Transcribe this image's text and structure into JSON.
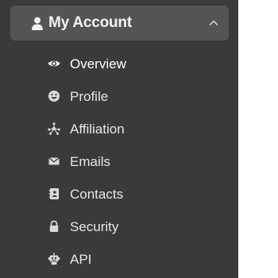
{
  "colors": {
    "sidebar_bg": "#3a3a3a",
    "header_bg": "#545454",
    "text": "#e6e6e6",
    "icon": "#d9d9d9"
  },
  "account": {
    "title": "My Account",
    "icon": "user-icon",
    "expanded": true,
    "items": [
      {
        "label": "Overview",
        "icon": "eye-icon",
        "active": true
      },
      {
        "label": "Profile",
        "icon": "smiley-icon",
        "active": false
      },
      {
        "label": "Affiliation",
        "icon": "network-icon",
        "active": false
      },
      {
        "label": "Emails",
        "icon": "envelope-icon",
        "active": false
      },
      {
        "label": "Contacts",
        "icon": "address-book-icon",
        "active": false
      },
      {
        "label": "Security",
        "icon": "lock-icon",
        "active": false
      },
      {
        "label": "API",
        "icon": "robot-icon",
        "active": false
      }
    ]
  }
}
